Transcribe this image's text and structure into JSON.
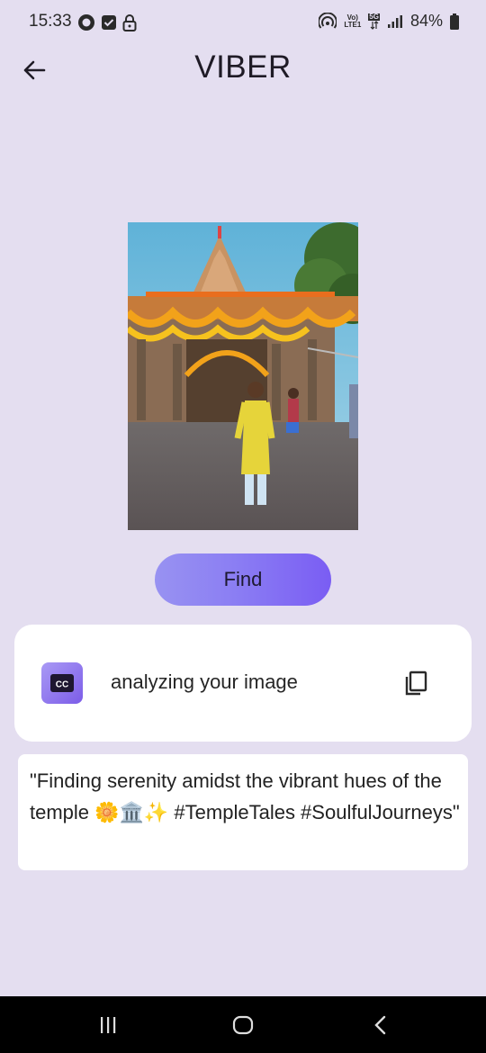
{
  "status_bar": {
    "time": "15:33",
    "battery": "84%",
    "network_labels": [
      "Vo)",
      "LTE1",
      "5G"
    ]
  },
  "app_bar": {
    "title": "VIBER",
    "back_icon": "arrow-left-icon"
  },
  "image": {
    "description_icon": "temple-photo"
  },
  "find_button": {
    "label": "Find"
  },
  "analysis_card": {
    "badge_text": "CC",
    "status_text": "analyzing your image",
    "copy_icon": "copy-icon"
  },
  "caption": {
    "text": "\"Finding serenity amidst the vibrant hues of the temple 🌼🏛️✨ #TempleTales #SoulfulJourneys\""
  },
  "colors": {
    "background": "#e4def0",
    "accent_start": "#9892f2",
    "accent_end": "#7a5df3"
  }
}
